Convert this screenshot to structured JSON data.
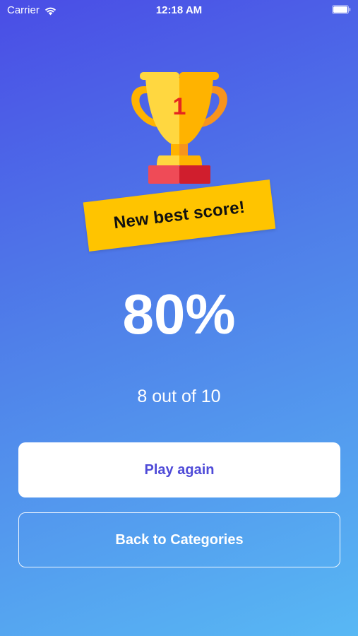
{
  "status_bar": {
    "carrier": "Carrier",
    "time": "12:18 AM",
    "icons": [
      "wifi-icon",
      "battery-icon"
    ]
  },
  "trophy": {
    "icon": "trophy-icon",
    "rank": "1"
  },
  "badge": {
    "text": "New best score!"
  },
  "result": {
    "percent": "80%",
    "detail": "8 out of 10"
  },
  "actions": {
    "play_again": "Play again",
    "back": "Back to Categories"
  },
  "colors": {
    "gradient_start": "#4a4de6",
    "gradient_end": "#58b8f4",
    "badge": "#ffc400",
    "primary_text": "#4f4bd8"
  }
}
